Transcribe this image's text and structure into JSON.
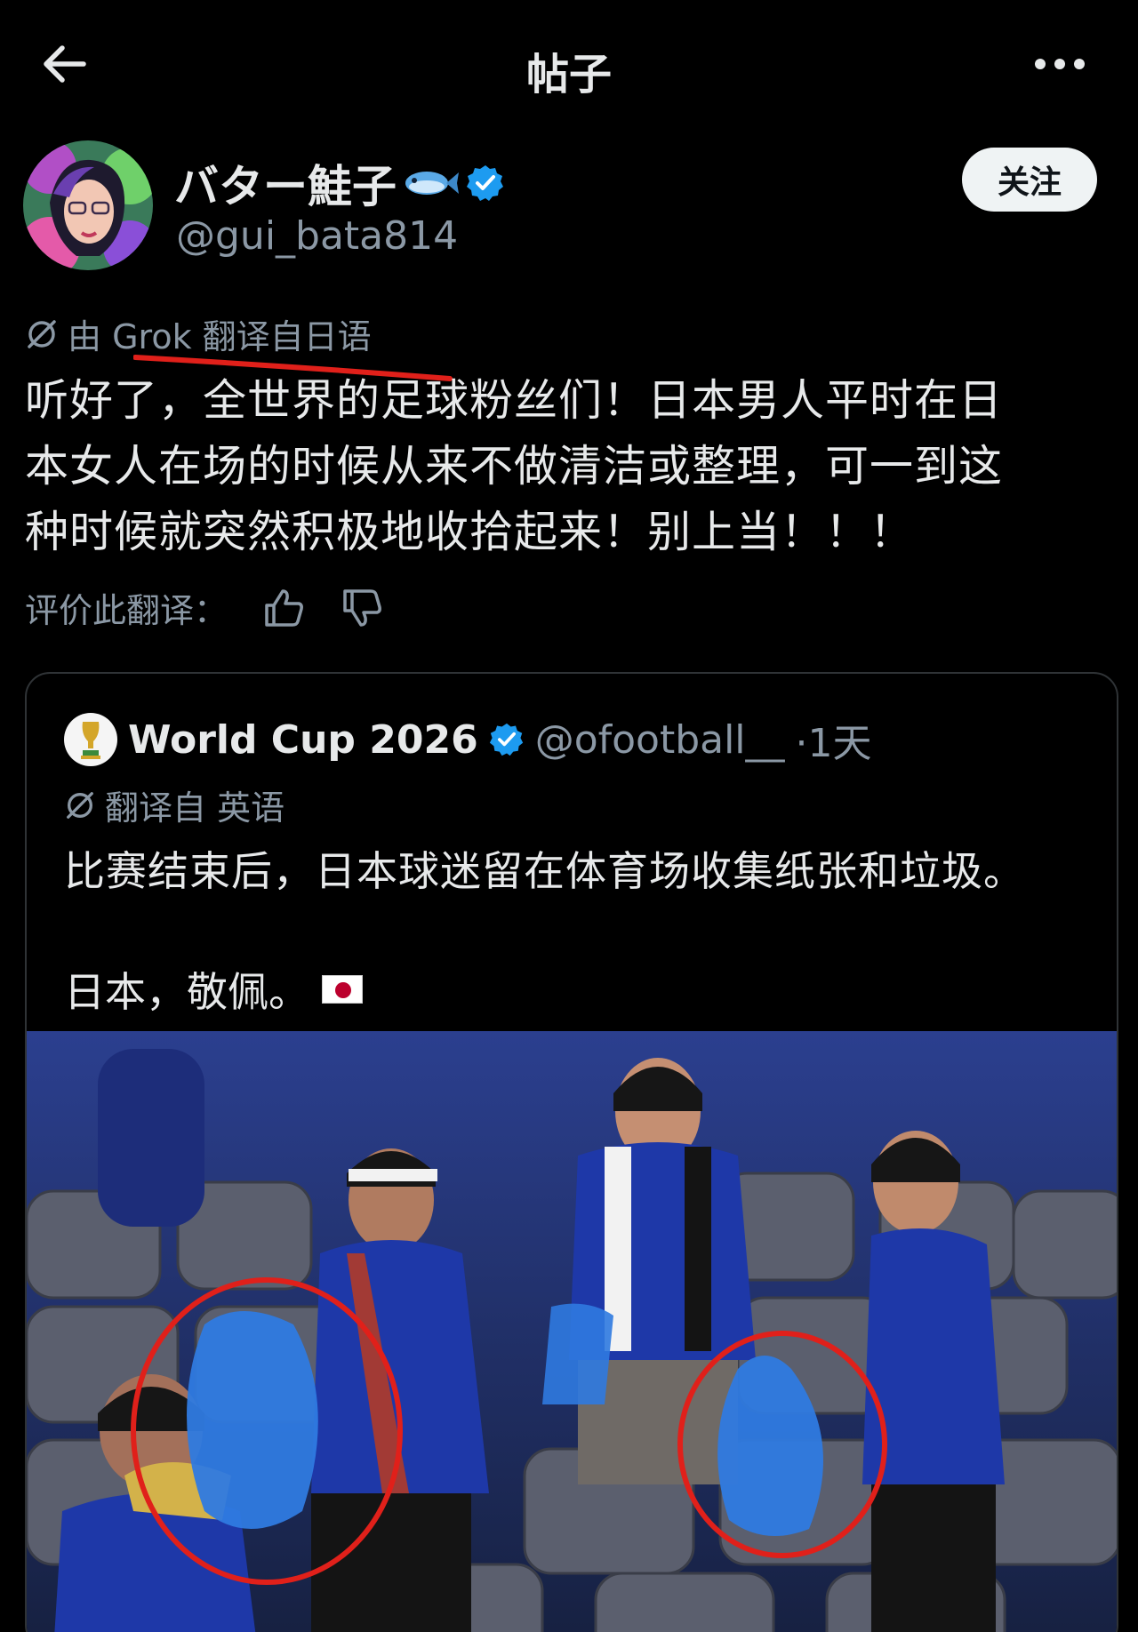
{
  "topbar": {
    "title": "帖子"
  },
  "post": {
    "author_name": "バター鮭子",
    "author_handle": "@gui_bata814",
    "follow_label": "关注",
    "translation_notice": "由 Grok 翻译自日语",
    "body_lines": [
      "听好了，全世界的足球粉丝们！日本男人平时在日",
      "本女人在场的时候从来不做清洁或整理，可一到这",
      "种时候就突然积极地收拾起来！别上当！！！"
    ],
    "rate_label": "评价此翻译："
  },
  "quote": {
    "name": "World Cup 2026",
    "handle": "@ofootball__",
    "time": "·1天",
    "translation_notice": "翻译自 英语",
    "line1": "比赛结束后，日本球迷留在体育场收集纸张和垃圾。",
    "line2": "日本，敬佩。"
  },
  "colors": {
    "background": "#000000",
    "text": "#e7e9ea",
    "muted": "#8b98a5",
    "verified": "#1d9bf0",
    "annotation_red": "#e0201a"
  },
  "icons": [
    "back-arrow-icon",
    "more-dots-icon",
    "verified-badge-icon",
    "fish-emoji-icon",
    "translate-icon",
    "thumbs-up-icon",
    "thumbs-down-icon",
    "trophy-icon",
    "japan-flag-icon"
  ]
}
